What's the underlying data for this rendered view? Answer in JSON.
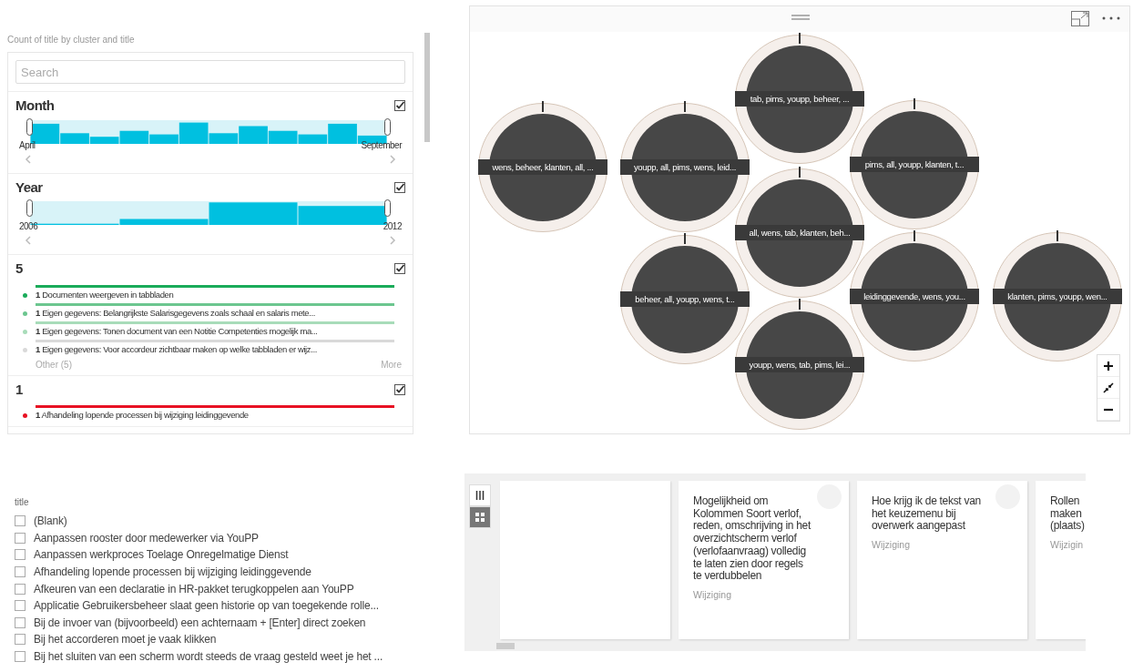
{
  "slicer_panel": {
    "title": "Count of title by cluster and title",
    "search": {
      "placeholder": "Search"
    },
    "timelines": [
      {
        "title": "Month",
        "checked": true,
        "start_label": "April",
        "end_label": "September",
        "kind": "month"
      },
      {
        "title": "Year",
        "checked": true,
        "start_label": "2006",
        "end_label": "2012",
        "kind": "year"
      }
    ],
    "clusters": [
      {
        "title": "5",
        "checked": true,
        "color": "#1aab5a",
        "items": [
          {
            "count": "1",
            "text": "Documenten weergeven in tabbladen",
            "color": "#1aab5a"
          },
          {
            "count": "1",
            "text": "Eigen gegevens: Belangrijkste Salarisgegevens zoals schaal en salaris mete...",
            "color": "#6cc68f"
          },
          {
            "count": "1",
            "text": "Eigen gegevens: Tonen document van een Notitie Competenties mogelijk ma...",
            "color": "#a8dcb9"
          },
          {
            "count": "1",
            "text": "Eigen gegevens: Voor accordeur zichtbaar maken op welke tabbladen er wijz...",
            "color": "#d9d9d9"
          }
        ],
        "other": "Other (5)",
        "more": "More"
      },
      {
        "title": "1",
        "checked": true,
        "color": "#e81123",
        "items": [
          {
            "count": "1",
            "text": "Afhandeling lopende processen bij wijziging leidinggevende",
            "color": "#e81123"
          }
        ]
      }
    ]
  },
  "bubble_chart": {
    "bubbles": [
      {
        "label": "wens, beheer, klanten, all, ..."
      },
      {
        "label": "youpp, all, pims, wens, leid..."
      },
      {
        "label": "tab, pims, youpp, beheer, ..."
      },
      {
        "label": "pims, all, youpp, klanten, t..."
      },
      {
        "label": "all, wens, tab, klanten, beh..."
      },
      {
        "label": "beheer, all, youpp, wens, t..."
      },
      {
        "label": "leidinggevende, wens, you..."
      },
      {
        "label": "klanten, pims, youpp, wen..."
      },
      {
        "label": "youpp, wens, tab, pims, lei..."
      }
    ]
  },
  "title_list": {
    "title": "title",
    "items": [
      {
        "text": "(Blank)",
        "checked": false
      },
      {
        "text": "Aanpassen rooster door medewerker via YouPP",
        "checked": false
      },
      {
        "text": "Aanpassen werkproces Toelage Onregelmatige Dienst",
        "checked": false
      },
      {
        "text": "Afhandeling lopende processen bij wijziging leidinggevende",
        "checked": false
      },
      {
        "text": "Afkeuren van een declaratie in HR-pakket terugkoppelen aan YouPP",
        "checked": false
      },
      {
        "text": "Applicatie Gebruikersbeheer slaat geen historie op van toegekende rolle...",
        "checked": false
      },
      {
        "text": "Bij de invoer van (bijvoorbeeld) een achternaam + [Enter] direct zoeken",
        "checked": false
      },
      {
        "text": "Bij het accorderen moet je vaak klikken",
        "checked": false
      },
      {
        "text": "Bij het sluiten van een scherm wordt steeds de vraag gesteld weet je het ...",
        "checked": false
      }
    ]
  },
  "card_view": {
    "view_modes": [
      {
        "kind": "columns",
        "selected": false
      },
      {
        "kind": "grid",
        "selected": true
      }
    ],
    "cards": [
      {
        "kind": "empty"
      },
      {
        "kind": "card",
        "title": "Mogelijkheid om Kolommen Soort verlof, reden, omschrijving in het overzichtscherm verlof (verlofaanvraag) volledig te laten zien door regels te verdubbelen",
        "tag": "Wijziging"
      },
      {
        "kind": "card",
        "title": "Hoe krijg ik de tekst van het keuzemenu bij overwerk aangepast",
        "tag": "Wijziging"
      },
      {
        "kind": "partial",
        "title": "Rollen\nmaken\n(plaats)",
        "tag": "Wijzigin"
      }
    ]
  }
}
